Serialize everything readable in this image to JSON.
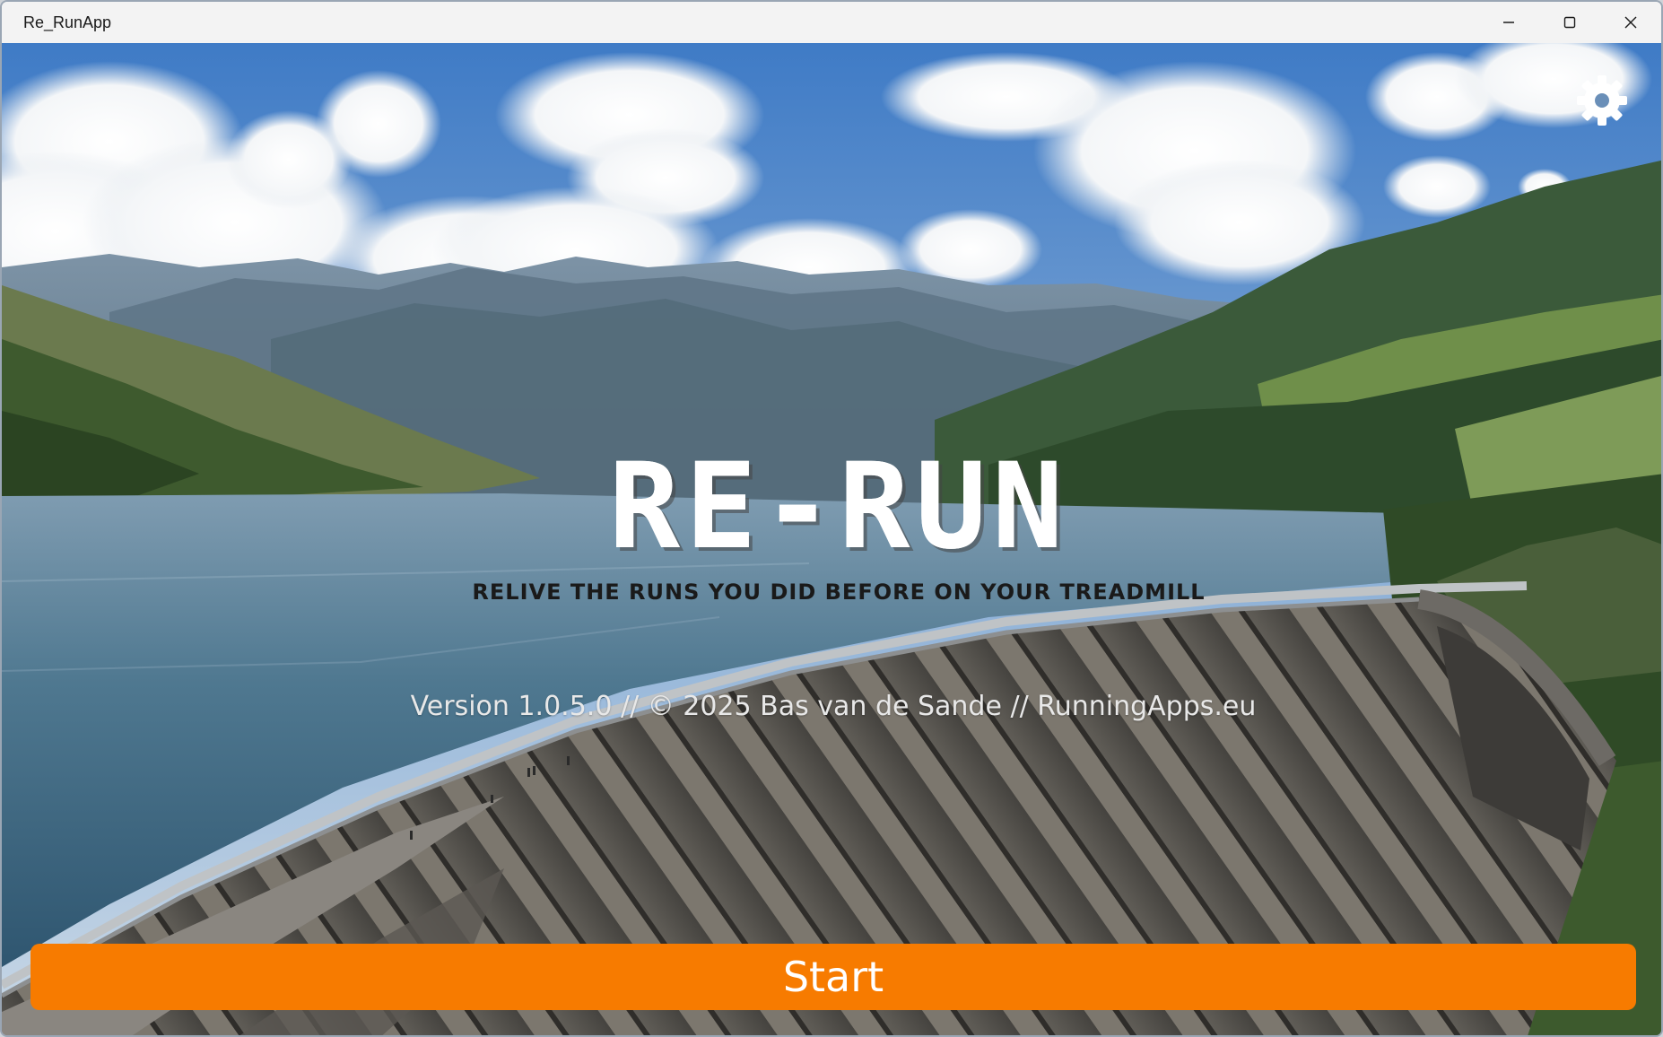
{
  "window": {
    "title": "Re_RunApp",
    "controls": [
      "minimize-icon",
      "maximize-icon",
      "close-icon"
    ]
  },
  "header": {
    "settings_icon": "gear-icon"
  },
  "hero": {
    "logo_text": "RE-RUN",
    "tagline": "RELIVE THE RUNS YOU DID BEFORE ON YOUR TREADMILL",
    "version_line": "Version 1.0.5.0  //  © 2025 Bas van de Sande  //  RunningApps.eu"
  },
  "actions": {
    "start_label": "Start"
  },
  "colors": {
    "accent": "#f77b00",
    "title_bar": "#f3f3f3",
    "logo_text": "#ffffff",
    "tagline_text": "#1a1a1a"
  }
}
